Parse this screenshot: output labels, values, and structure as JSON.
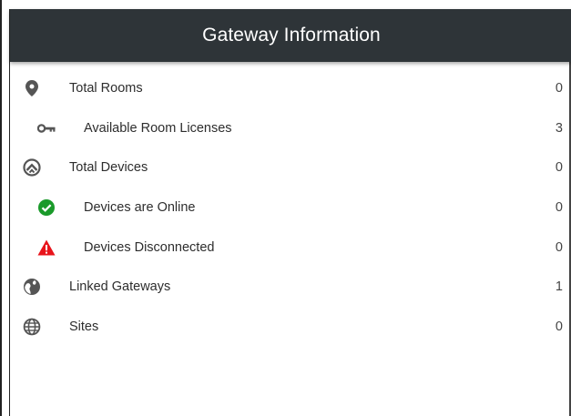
{
  "header": {
    "title": "Gateway Information"
  },
  "rows": [
    {
      "label": "Total Rooms",
      "value": "0",
      "icon": "location-pin-icon"
    },
    {
      "label": "Available Room Licenses",
      "value": "3",
      "icon": "key-icon"
    },
    {
      "label": "Total Devices",
      "value": "0",
      "icon": "devices-chevron-icon"
    },
    {
      "label": "Devices are Online",
      "value": "0",
      "icon": "check-circle-icon"
    },
    {
      "label": "Devices Disconnected",
      "value": "0",
      "icon": "warning-triangle-icon"
    },
    {
      "label": "Linked Gateways",
      "value": "1",
      "icon": "globe-filled-icon"
    },
    {
      "label": "Sites",
      "value": "0",
      "icon": "globe-outline-icon"
    }
  ],
  "colors": {
    "header_bg": "#2e3438",
    "online": "#1a9a2a",
    "alert": "#e8141b",
    "icon": "#555555"
  }
}
